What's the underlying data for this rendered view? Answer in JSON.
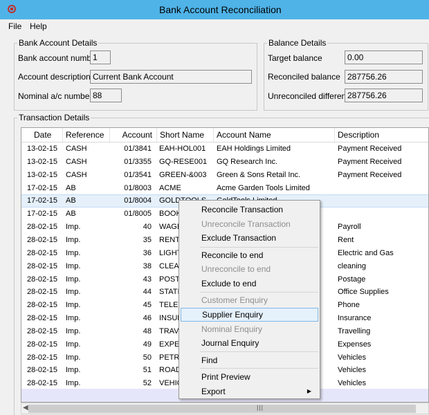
{
  "window": {
    "title": "Bank Account Reconciliation"
  },
  "menu": [
    "File",
    "Help"
  ],
  "bank_details": {
    "legend": "Bank Account Details",
    "account_number_label": "Bank account number",
    "account_number": "1",
    "description_label": "Account description",
    "description": "Current Bank Account",
    "nominal_label": "Nominal a/c number",
    "nominal": "88"
  },
  "balance_details": {
    "legend": "Balance Details",
    "target_label": "Target balance",
    "target": "0.00",
    "reconciled_label": "Reconciled balance",
    "reconciled": "287756.26",
    "unreconciled_label": "Unreconciled difference",
    "unreconciled": "287756.26"
  },
  "transactions": {
    "legend": "Transaction Details",
    "columns": [
      "Date",
      "Reference",
      "Account",
      "Short Name",
      "Account Name",
      "Description"
    ],
    "rows": [
      {
        "date": "13-02-15",
        "ref": "CASH",
        "account": "01/3841",
        "short": "EAH-HOL001",
        "name": "EAH Holdings Limited",
        "desc": "Payment Received"
      },
      {
        "date": "13-02-15",
        "ref": "CASH",
        "account": "01/3355",
        "short": "GQ-RESE001",
        "name": "GQ Research Inc.",
        "desc": "Payment Received"
      },
      {
        "date": "13-02-15",
        "ref": "CASH",
        "account": "01/3541",
        "short": "GREEN-&003",
        "name": "Green & Sons Retail Inc.",
        "desc": "Payment Received"
      },
      {
        "date": "17-02-15",
        "ref": "AB",
        "account": "01/8003",
        "short": "ACME",
        "name": "Acme Garden Tools Limited",
        "desc": ""
      },
      {
        "date": "17-02-15",
        "ref": "AB",
        "account": "01/8004",
        "short": "GOLDTOOLS",
        "name": "GoldTools Limited",
        "desc": ""
      },
      {
        "date": "17-02-15",
        "ref": "AB",
        "account": "01/8005",
        "short": "BOOK",
        "name": "",
        "desc": ""
      },
      {
        "date": "28-02-15",
        "ref": "Imp.",
        "account": "40",
        "short": "WAGE",
        "name": "",
        "desc": "Payroll"
      },
      {
        "date": "28-02-15",
        "ref": "Imp.",
        "account": "35",
        "short": "RENT",
        "name": "",
        "desc": "Rent"
      },
      {
        "date": "28-02-15",
        "ref": "Imp.",
        "account": "36",
        "short": "LIGHT",
        "name": "",
        "desc": "Electric and Gas"
      },
      {
        "date": "28-02-15",
        "ref": "Imp.",
        "account": "38",
        "short": "CLEAN",
        "name": "",
        "desc": "cleaning"
      },
      {
        "date": "28-02-15",
        "ref": "Imp.",
        "account": "43",
        "short": "POST.",
        "name": "",
        "desc": "Postage"
      },
      {
        "date": "28-02-15",
        "ref": "Imp.",
        "account": "44",
        "short": "STATI",
        "name": "",
        "desc": "Office Supplies"
      },
      {
        "date": "28-02-15",
        "ref": "Imp.",
        "account": "45",
        "short": "TELEP",
        "name": "",
        "desc": "Phone"
      },
      {
        "date": "28-02-15",
        "ref": "Imp.",
        "account": "46",
        "short": "INSUR",
        "name": "",
        "desc": "Insurance"
      },
      {
        "date": "28-02-15",
        "ref": "Imp.",
        "account": "48",
        "short": "TRAV",
        "name": "",
        "desc": "Travelling"
      },
      {
        "date": "28-02-15",
        "ref": "Imp.",
        "account": "49",
        "short": "EXPEN",
        "name": "",
        "desc": "Expenses"
      },
      {
        "date": "28-02-15",
        "ref": "Imp.",
        "account": "50",
        "short": "PETRO",
        "name": "",
        "desc": "Vehicles"
      },
      {
        "date": "28-02-15",
        "ref": "Imp.",
        "account": "51",
        "short": "ROAD",
        "name": "",
        "desc": "Vehicles"
      },
      {
        "date": "28-02-15",
        "ref": "Imp.",
        "account": "52",
        "short": "VEHIC",
        "name": "",
        "desc": "Vehicles"
      }
    ]
  },
  "context_menu": {
    "items": [
      {
        "label": "Reconcile Transaction",
        "enabled": true
      },
      {
        "label": "Unreconcile Transaction",
        "enabled": false
      },
      {
        "label": "Exclude Transaction",
        "enabled": true
      },
      {
        "label": "Reconcile to end",
        "enabled": true
      },
      {
        "label": "Unreconcile to end",
        "enabled": false
      },
      {
        "label": "Exclude to end",
        "enabled": true
      },
      {
        "label": "Customer Enquiry",
        "enabled": false
      },
      {
        "label": "Supplier Enquiry",
        "enabled": true,
        "highlighted": true
      },
      {
        "label": "Nominal Enquiry",
        "enabled": false
      },
      {
        "label": "Journal Enquiry",
        "enabled": true
      },
      {
        "label": "Find",
        "enabled": true
      },
      {
        "label": "Print Preview",
        "enabled": true
      },
      {
        "label": "Export",
        "enabled": true,
        "submenu": true
      }
    ]
  },
  "colors": {
    "titlebar": "#4fb3e8",
    "selected_row": "#e5f0fb",
    "menu_highlight": "#e5f1fb",
    "bottom_band": "#e6e6fa"
  }
}
